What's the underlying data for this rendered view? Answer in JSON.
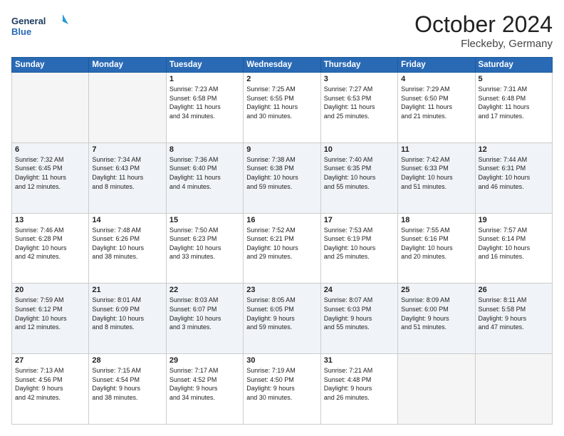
{
  "logo": {
    "line1": "General",
    "line2": "Blue"
  },
  "title": "October 2024",
  "location": "Fleckeby, Germany",
  "days_of_week": [
    "Sunday",
    "Monday",
    "Tuesday",
    "Wednesday",
    "Thursday",
    "Friday",
    "Saturday"
  ],
  "weeks": [
    [
      {
        "day": "",
        "info": ""
      },
      {
        "day": "",
        "info": ""
      },
      {
        "day": "1",
        "info": "Sunrise: 7:23 AM\nSunset: 6:58 PM\nDaylight: 11 hours\nand 34 minutes."
      },
      {
        "day": "2",
        "info": "Sunrise: 7:25 AM\nSunset: 6:55 PM\nDaylight: 11 hours\nand 30 minutes."
      },
      {
        "day": "3",
        "info": "Sunrise: 7:27 AM\nSunset: 6:53 PM\nDaylight: 11 hours\nand 25 minutes."
      },
      {
        "day": "4",
        "info": "Sunrise: 7:29 AM\nSunset: 6:50 PM\nDaylight: 11 hours\nand 21 minutes."
      },
      {
        "day": "5",
        "info": "Sunrise: 7:31 AM\nSunset: 6:48 PM\nDaylight: 11 hours\nand 17 minutes."
      }
    ],
    [
      {
        "day": "6",
        "info": "Sunrise: 7:32 AM\nSunset: 6:45 PM\nDaylight: 11 hours\nand 12 minutes."
      },
      {
        "day": "7",
        "info": "Sunrise: 7:34 AM\nSunset: 6:43 PM\nDaylight: 11 hours\nand 8 minutes."
      },
      {
        "day": "8",
        "info": "Sunrise: 7:36 AM\nSunset: 6:40 PM\nDaylight: 11 hours\nand 4 minutes."
      },
      {
        "day": "9",
        "info": "Sunrise: 7:38 AM\nSunset: 6:38 PM\nDaylight: 10 hours\nand 59 minutes."
      },
      {
        "day": "10",
        "info": "Sunrise: 7:40 AM\nSunset: 6:35 PM\nDaylight: 10 hours\nand 55 minutes."
      },
      {
        "day": "11",
        "info": "Sunrise: 7:42 AM\nSunset: 6:33 PM\nDaylight: 10 hours\nand 51 minutes."
      },
      {
        "day": "12",
        "info": "Sunrise: 7:44 AM\nSunset: 6:31 PM\nDaylight: 10 hours\nand 46 minutes."
      }
    ],
    [
      {
        "day": "13",
        "info": "Sunrise: 7:46 AM\nSunset: 6:28 PM\nDaylight: 10 hours\nand 42 minutes."
      },
      {
        "day": "14",
        "info": "Sunrise: 7:48 AM\nSunset: 6:26 PM\nDaylight: 10 hours\nand 38 minutes."
      },
      {
        "day": "15",
        "info": "Sunrise: 7:50 AM\nSunset: 6:23 PM\nDaylight: 10 hours\nand 33 minutes."
      },
      {
        "day": "16",
        "info": "Sunrise: 7:52 AM\nSunset: 6:21 PM\nDaylight: 10 hours\nand 29 minutes."
      },
      {
        "day": "17",
        "info": "Sunrise: 7:53 AM\nSunset: 6:19 PM\nDaylight: 10 hours\nand 25 minutes."
      },
      {
        "day": "18",
        "info": "Sunrise: 7:55 AM\nSunset: 6:16 PM\nDaylight: 10 hours\nand 20 minutes."
      },
      {
        "day": "19",
        "info": "Sunrise: 7:57 AM\nSunset: 6:14 PM\nDaylight: 10 hours\nand 16 minutes."
      }
    ],
    [
      {
        "day": "20",
        "info": "Sunrise: 7:59 AM\nSunset: 6:12 PM\nDaylight: 10 hours\nand 12 minutes."
      },
      {
        "day": "21",
        "info": "Sunrise: 8:01 AM\nSunset: 6:09 PM\nDaylight: 10 hours\nand 8 minutes."
      },
      {
        "day": "22",
        "info": "Sunrise: 8:03 AM\nSunset: 6:07 PM\nDaylight: 10 hours\nand 3 minutes."
      },
      {
        "day": "23",
        "info": "Sunrise: 8:05 AM\nSunset: 6:05 PM\nDaylight: 9 hours\nand 59 minutes."
      },
      {
        "day": "24",
        "info": "Sunrise: 8:07 AM\nSunset: 6:03 PM\nDaylight: 9 hours\nand 55 minutes."
      },
      {
        "day": "25",
        "info": "Sunrise: 8:09 AM\nSunset: 6:00 PM\nDaylight: 9 hours\nand 51 minutes."
      },
      {
        "day": "26",
        "info": "Sunrise: 8:11 AM\nSunset: 5:58 PM\nDaylight: 9 hours\nand 47 minutes."
      }
    ],
    [
      {
        "day": "27",
        "info": "Sunrise: 7:13 AM\nSunset: 4:56 PM\nDaylight: 9 hours\nand 42 minutes."
      },
      {
        "day": "28",
        "info": "Sunrise: 7:15 AM\nSunset: 4:54 PM\nDaylight: 9 hours\nand 38 minutes."
      },
      {
        "day": "29",
        "info": "Sunrise: 7:17 AM\nSunset: 4:52 PM\nDaylight: 9 hours\nand 34 minutes."
      },
      {
        "day": "30",
        "info": "Sunrise: 7:19 AM\nSunset: 4:50 PM\nDaylight: 9 hours\nand 30 minutes."
      },
      {
        "day": "31",
        "info": "Sunrise: 7:21 AM\nSunset: 4:48 PM\nDaylight: 9 hours\nand 26 minutes."
      },
      {
        "day": "",
        "info": ""
      },
      {
        "day": "",
        "info": ""
      }
    ]
  ]
}
